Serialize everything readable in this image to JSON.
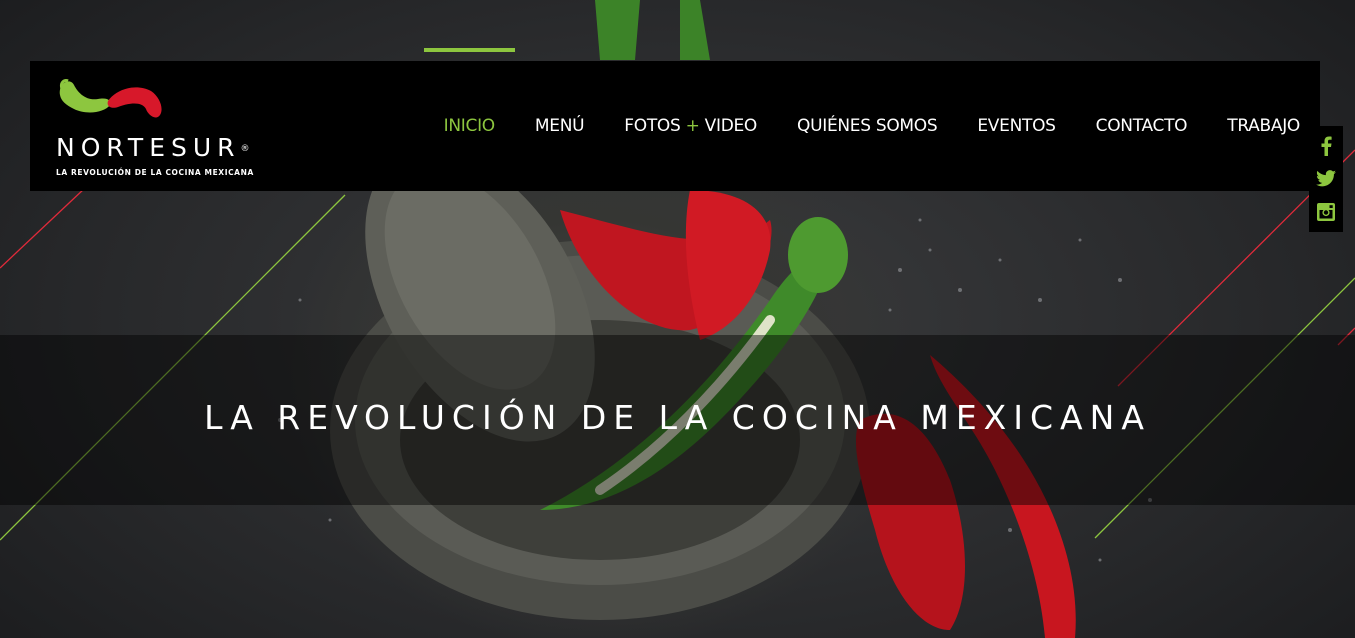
{
  "brand": {
    "name": "NORTESUR",
    "registered": "®",
    "tagline_small": "LA REVOLUCIÓN DE LA COCINA MEXICANA",
    "colors": {
      "green": "#8dc63f",
      "red": "#d7182a",
      "black": "#000000"
    }
  },
  "nav": {
    "items": [
      {
        "label": "INICIO",
        "active": true
      },
      {
        "label": "MENÚ",
        "active": false
      },
      {
        "label_a": "FOTOS ",
        "plus": "+",
        "label_b": " VIDEO",
        "active": false
      },
      {
        "label": "QUIÉNES SOMOS",
        "active": false
      },
      {
        "label": "EVENTOS",
        "active": false
      },
      {
        "label": "CONTACTO",
        "active": false
      },
      {
        "label": "TRABAJO",
        "active": false
      }
    ]
  },
  "social": {
    "icons": [
      "facebook-icon",
      "twitter-icon",
      "instagram-icon"
    ]
  },
  "hero": {
    "headline": "LA REVOLUCIÓN DE LA COCINA MEXICANA",
    "image": "stone molcajete with green and red chili peppers on dark wet surface"
  }
}
